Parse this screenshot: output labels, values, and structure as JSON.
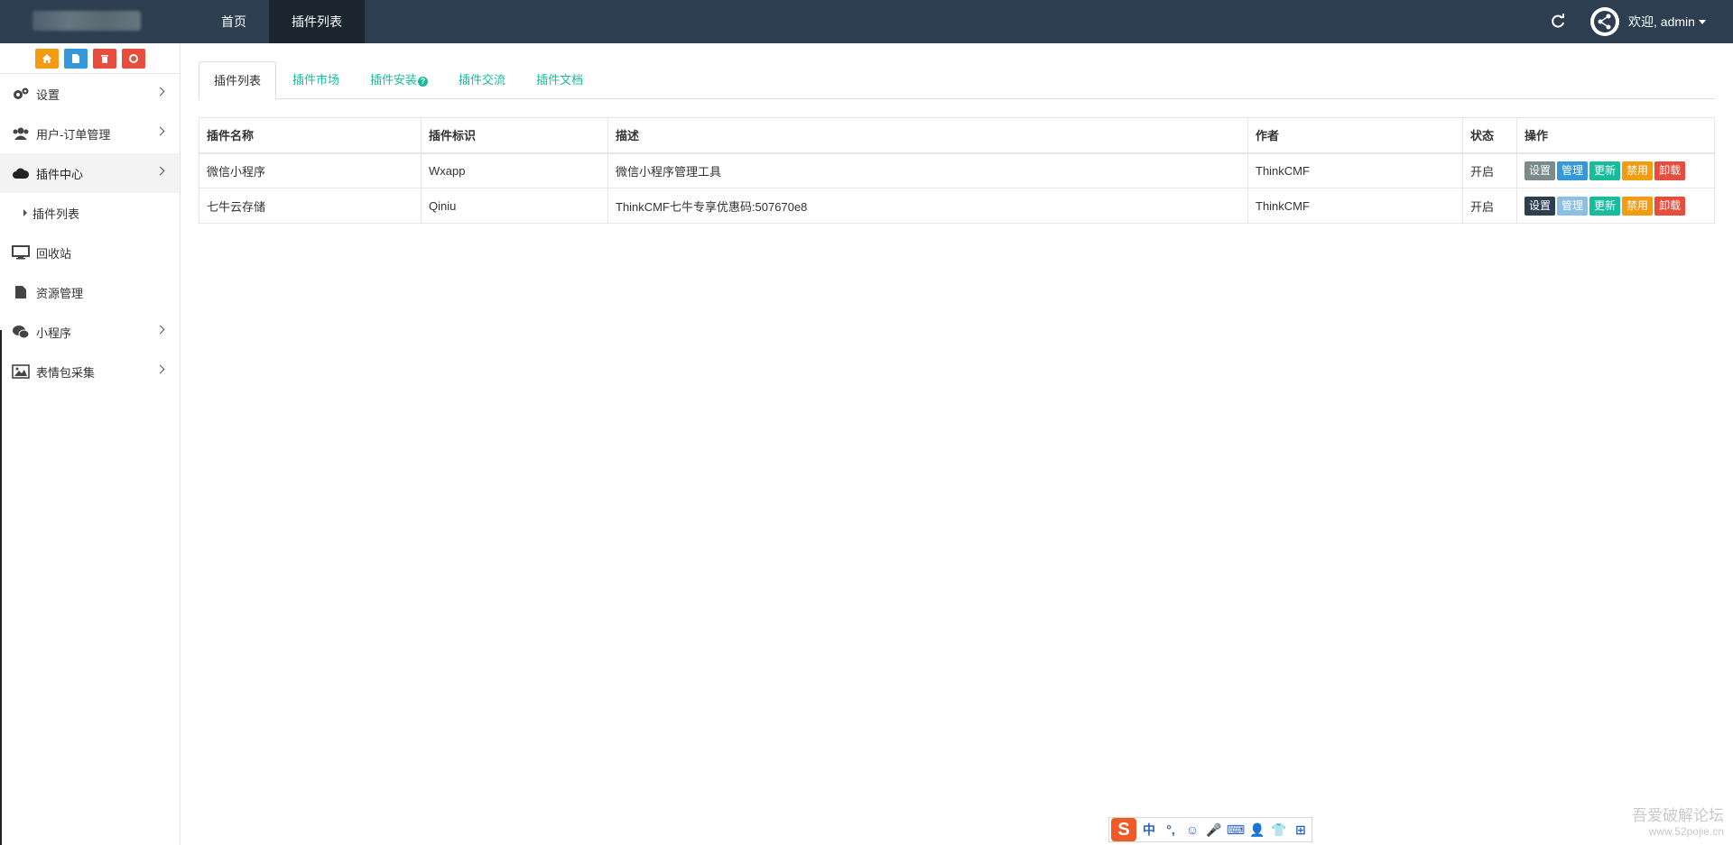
{
  "topbar": {
    "nav": [
      {
        "label": "首页"
      },
      {
        "label": "插件列表"
      }
    ],
    "user_label": "欢迎, admin"
  },
  "sidebar": {
    "shortcuts": [
      {
        "icon": "home-icon",
        "color": "#f39c12"
      },
      {
        "icon": "file-icon",
        "color": "#3498db"
      },
      {
        "icon": "trash-icon",
        "color": "#e74c3c"
      },
      {
        "icon": "recycle-icon",
        "color": "#e74c3c"
      }
    ],
    "items": [
      {
        "label": "设置",
        "icon": "gears-icon"
      },
      {
        "label": "用户-订单管理",
        "icon": "users-icon"
      },
      {
        "label": "插件中心",
        "icon": "cloud-icon"
      },
      {
        "label": "插件列表"
      },
      {
        "label": "回收站",
        "icon": "desktop-icon"
      },
      {
        "label": "资源管理",
        "icon": "file-icon"
      },
      {
        "label": "小程序",
        "icon": "wechat-icon"
      },
      {
        "label": "表情包采集",
        "icon": "image-icon"
      }
    ]
  },
  "tabs": [
    {
      "label": "插件列表"
    },
    {
      "label": "插件市场"
    },
    {
      "label": "插件安装"
    },
    {
      "label": "插件交流"
    },
    {
      "label": "插件文档"
    }
  ],
  "table": {
    "headers": [
      "插件名称",
      "插件标识",
      "描述",
      "作者",
      "状态",
      "操作"
    ],
    "rows": [
      {
        "name": "微信小程序",
        "id": "Wxapp",
        "desc": "微信小程序管理工具",
        "author": "ThinkCMF",
        "status": "开启",
        "ops": [
          "设置",
          "管理",
          "更新",
          "禁用",
          "卸载"
        ]
      },
      {
        "name": "七牛云存储",
        "id": "Qiniu",
        "desc": "ThinkCMF七牛专享优惠码:507670e8",
        "author": "ThinkCMF",
        "status": "开启",
        "ops": [
          "设置",
          "管理",
          "更新",
          "禁用",
          "卸载"
        ]
      }
    ]
  },
  "ime": {
    "logo": "S",
    "keys": [
      "中",
      "°,",
      "☺",
      "🎤",
      "⌨",
      "👤",
      "👕",
      "⊞"
    ]
  },
  "watermark": {
    "line1": "吾爱破解论坛",
    "line2": "www.52pojie.cn"
  }
}
